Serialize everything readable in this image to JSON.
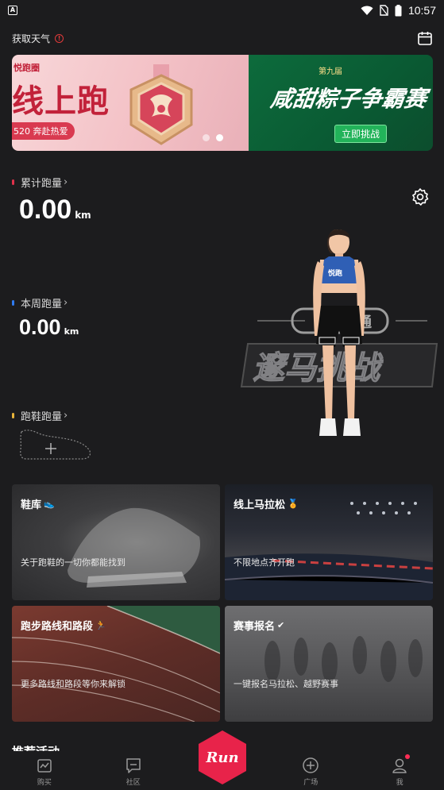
{
  "status_bar": {
    "time": "10:57"
  },
  "header": {
    "weather_label": "获取天气",
    "weather_alert": "!"
  },
  "banner": {
    "left": {
      "brand": "悦跑圈",
      "title": "线上跑",
      "tag": "520 奔赴热爱"
    },
    "right": {
      "edition": "第九届",
      "title": "咸甜粽子争霸赛",
      "button": "立即挑战"
    },
    "slides": 2,
    "active_slide": 2
  },
  "stats": [
    {
      "label": "累计跑量",
      "value": "0.00",
      "unit": "km",
      "color": "#e0314b"
    },
    {
      "label": "本周跑量",
      "value": "0.00",
      "unit": "km",
      "color": "#2f7bf0"
    },
    {
      "label": "跑鞋跑量",
      "color": "#e8b43a"
    }
  ],
  "avatar": {
    "shirt_text": "悦跑",
    "backdrop_text": "悦跑圈"
  },
  "cards": [
    {
      "title": "鞋库",
      "desc": "关于跑鞋的一切你都能找到"
    },
    {
      "title": "线上马拉松",
      "desc": "不限地点齐开跑"
    },
    {
      "title": "跑步路线和路段",
      "desc": "更多路线和路段等你来解锁"
    },
    {
      "title": "赛事报名",
      "desc": "一键报名马拉松、越野赛事"
    }
  ],
  "next_section_title": "推荐活动",
  "tabbar": {
    "tabs": [
      {
        "label": "购买",
        "icon": "shop-icon"
      },
      {
        "label": "社区",
        "icon": "chat-icon"
      },
      {
        "label": "广场",
        "icon": "plus-circle-icon"
      },
      {
        "label": "我",
        "icon": "person-icon"
      }
    ],
    "run_label": "Run",
    "accent": "#e8234a"
  }
}
